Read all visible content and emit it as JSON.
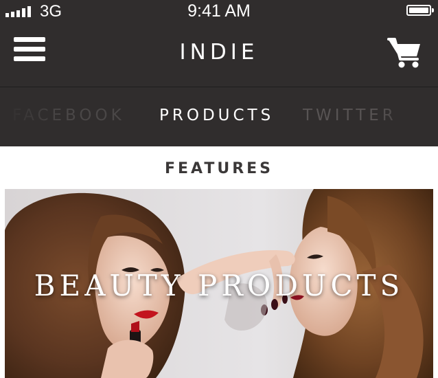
{
  "status_bar": {
    "carrier": "3G",
    "time": "9:41 AM",
    "signal_bars": 5,
    "battery_level": 1.0
  },
  "nav_bar": {
    "title": "INDIE",
    "menu_icon": "hamburger-menu-icon",
    "cart_icon": "shopping-cart-icon"
  },
  "tabs": [
    {
      "label": "FACEBOOK",
      "active": false
    },
    {
      "label": "PRODUCTS",
      "active": true
    },
    {
      "label": "TWITTER",
      "active": false
    }
  ],
  "section": {
    "title": "FEATURES"
  },
  "feature": {
    "caption": "BEAUTY PRODUCTS",
    "image_description": "photo"
  },
  "colors": {
    "bar_background": "#302d2d",
    "active_tab": "#ffffff",
    "inactive_tab": "#585454",
    "lipstick": "#c3141e"
  }
}
